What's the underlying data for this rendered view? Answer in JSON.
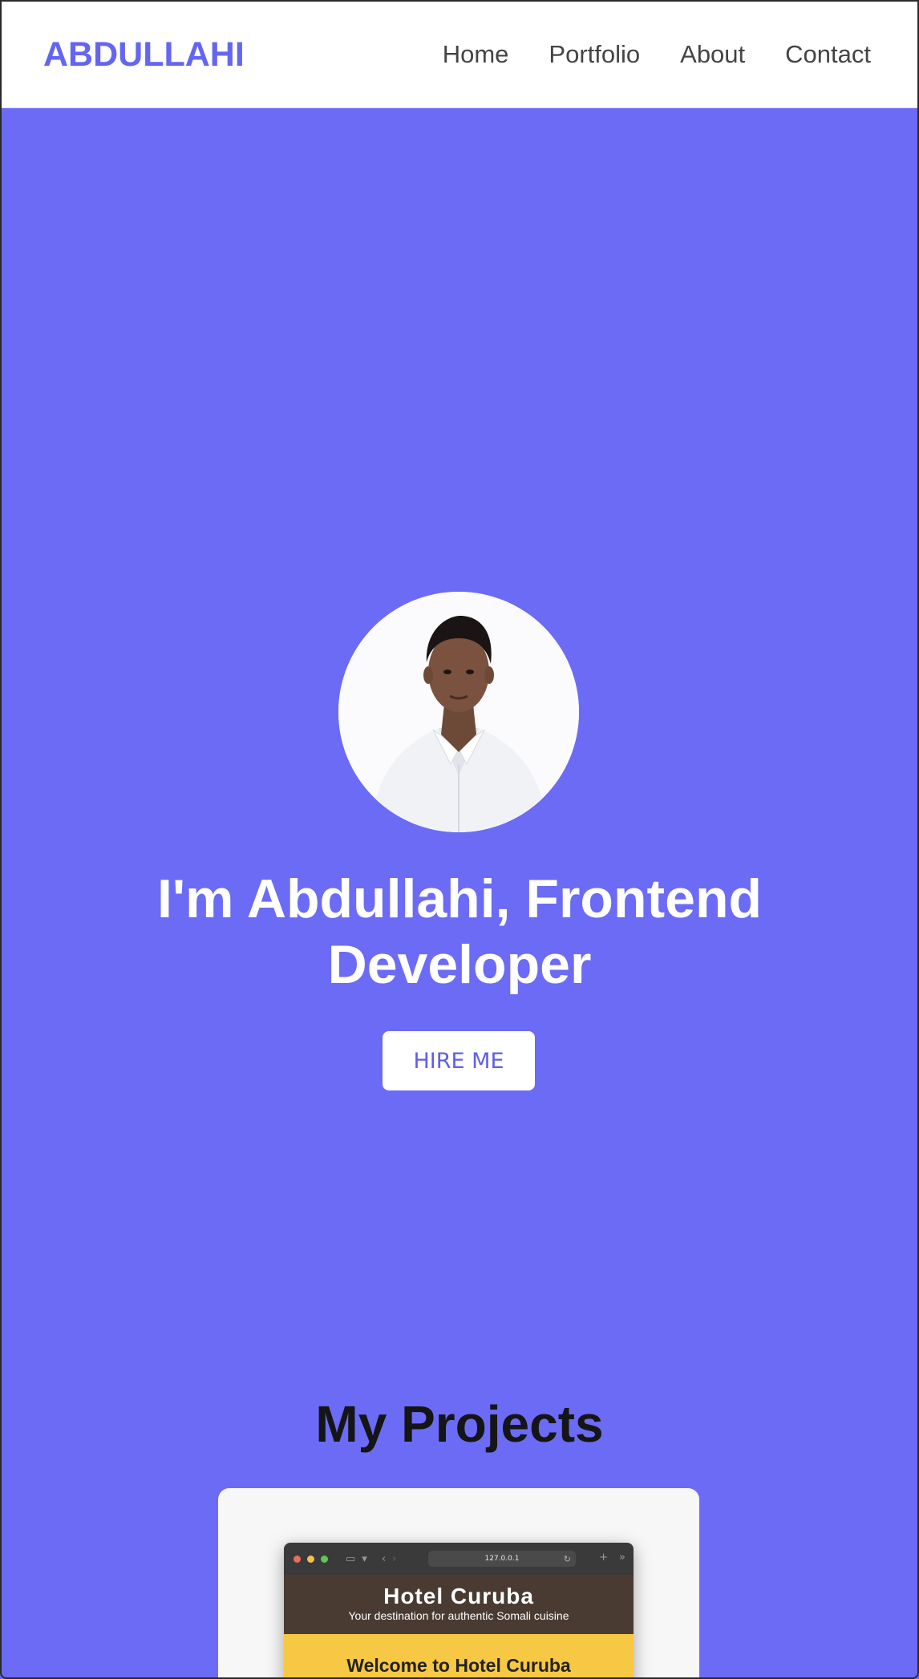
{
  "navbar": {
    "brand": "ABDULLAHI",
    "links": [
      "Home",
      "Portfolio",
      "About",
      "Contact"
    ]
  },
  "hero": {
    "title_line1": "I'm Abdullahi, Frontend",
    "title_line2": "Developer",
    "hire_label": "HIRE ME"
  },
  "projects": {
    "title": "My Projects",
    "card": {
      "browser": {
        "url": "127.0.0.1"
      },
      "site_title": "Hotel Curuba",
      "site_tagline": "Your destination for authentic Somali cuisine",
      "site_welcome": "Welcome to Hotel Curuba"
    }
  },
  "colors": {
    "accent": "#6b6bf5",
    "brand": "#6466f1",
    "hotel_header": "#4a3b32",
    "hotel_welcome": "#f7c843"
  }
}
